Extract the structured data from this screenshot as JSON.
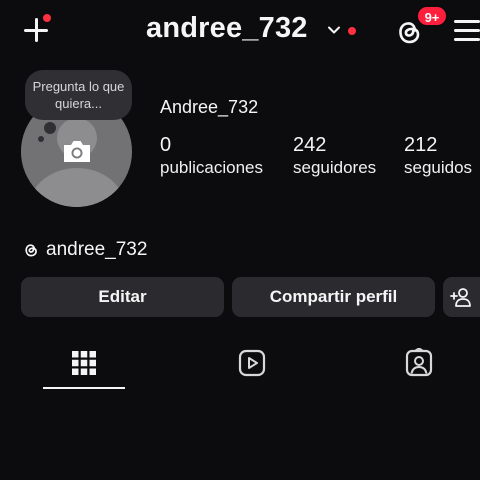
{
  "header": {
    "username": "andree_732",
    "notification_badge": "9+",
    "accent_color": "#ff3040"
  },
  "profile": {
    "note_text": "Pregunta lo que quiera...",
    "display_name": "Andree_732",
    "avatar_icon": "camera-icon",
    "stats": [
      {
        "value": "0",
        "label": "publicaciones"
      },
      {
        "value": "242",
        "label": "seguidores"
      },
      {
        "value": "212",
        "label": "seguidos"
      }
    ],
    "threads_handle": "andree_732"
  },
  "actions": {
    "edit_label": "Editar",
    "share_label": "Compartir perfil",
    "add_icon": "add-person-icon"
  },
  "tabs": [
    {
      "icon": "grid-icon",
      "active": true
    },
    {
      "icon": "reels-icon",
      "active": false
    },
    {
      "icon": "tagged-icon",
      "active": false
    }
  ]
}
